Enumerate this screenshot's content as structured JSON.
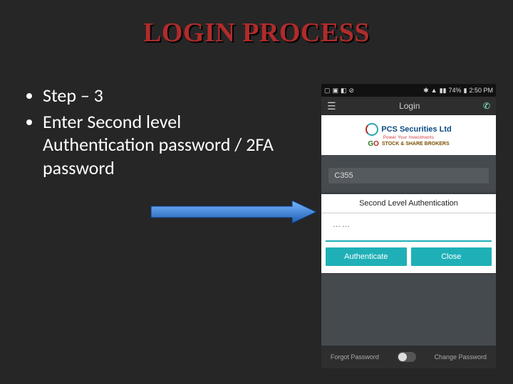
{
  "title": "LOGIN PROCESS",
  "bullets": {
    "b1": "Step – 3",
    "b2": "Enter Second level Authentication password / 2FA password"
  },
  "phone": {
    "statusbar": {
      "signal": "74%",
      "time": "2:50 PM"
    },
    "topbar": {
      "title": "Login"
    },
    "brand": {
      "name": "PCS Securities Ltd",
      "tag1": "Power Your Investments",
      "tag2": "STOCK & SHARE BROKERS",
      "go": "G"
    },
    "user_id": "C355",
    "modal": {
      "heading": "Second Level Authentication",
      "input_value": "……",
      "btn1": "Authenticate",
      "btn2": "Close"
    },
    "bottom": {
      "left": "Forgot Password",
      "right": "Change Password"
    }
  }
}
